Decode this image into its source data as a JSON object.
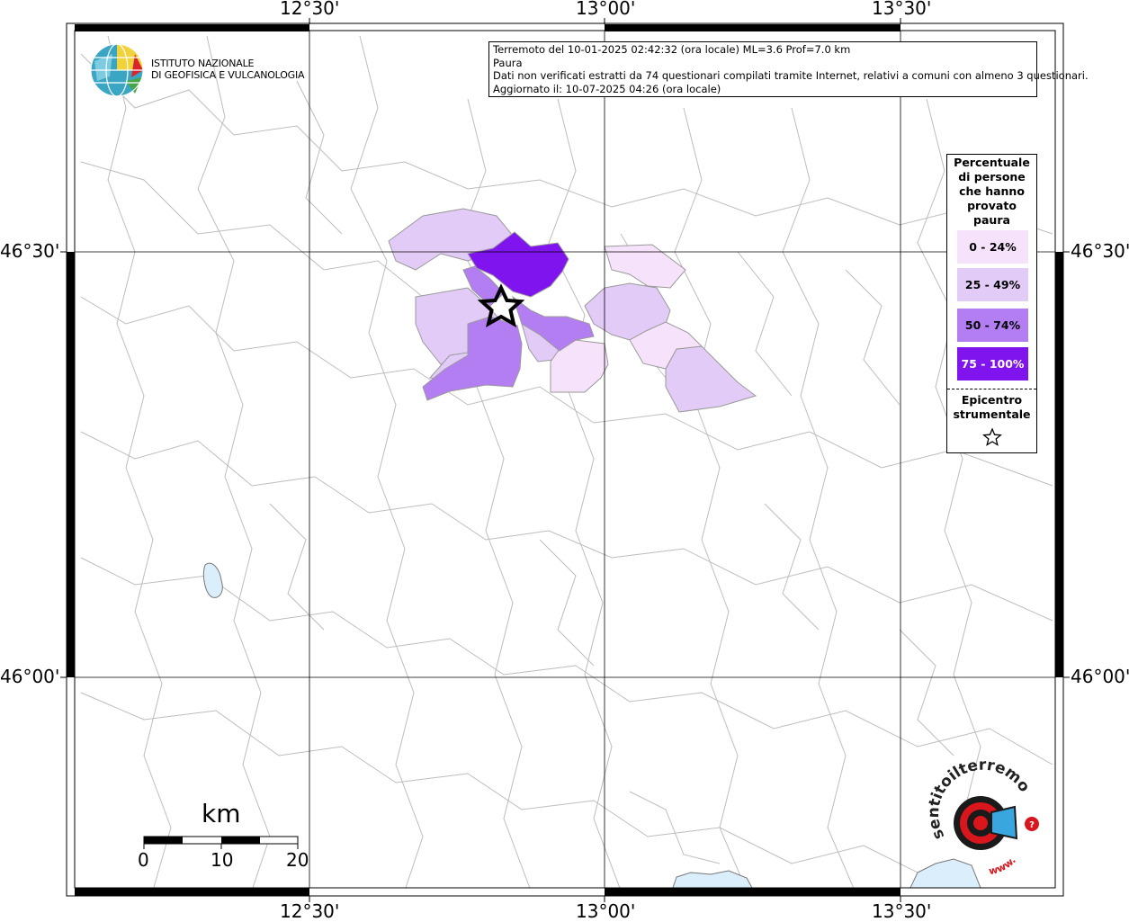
{
  "map": {
    "top_ticks": [
      "12°30'",
      "13°00'",
      "13°30'"
    ],
    "bottom_ticks": [
      "12°30'",
      "13°00'",
      "13°30'"
    ],
    "left_ticks": [
      "46°30'",
      "46°00'"
    ],
    "right_ticks": [
      "46°30'",
      "46°00'"
    ]
  },
  "institute": {
    "line1": "ISTITUTO NAZIONALE",
    "line2": "DI GEOFISICA E VULCANOLOGIA"
  },
  "info": {
    "line1": "Terremoto del 10-01-2025 02:42:32 (ora locale) ML=3.6 Prof=7.0 km",
    "line2": "Paura",
    "line3": "Dati non verificati estratti da 74 questionari compilati tramite Internet, relativi a comuni con almeno 3 questionari.",
    "line4": "Aggiornato il: 10-07-2025 04:26 (ora locale)"
  },
  "legend": {
    "title": [
      "Percentuale",
      "di persone",
      "che hanno",
      "provato",
      "paura"
    ],
    "classes": [
      {
        "label": "0 - 24%",
        "color": "#f7e2fb",
        "text_color": "#000000"
      },
      {
        "label": "25 - 49%",
        "color": "#e2cbf7",
        "text_color": "#000000"
      },
      {
        "label": "50 - 74%",
        "color": "#b37ef2",
        "text_color": "#000000"
      },
      {
        "label": "75 - 100%",
        "color": "#8014ee",
        "text_color": "#ffffff"
      }
    ],
    "epicenter_line1": "Epicentro",
    "epicenter_line2": "strumentale"
  },
  "scale": {
    "unit": "km",
    "labels": [
      "0",
      "10",
      "20"
    ]
  },
  "brand": {
    "text": "sentitoilterremoto.it",
    "url_text": "www.",
    "accent": "#d9161c"
  }
}
